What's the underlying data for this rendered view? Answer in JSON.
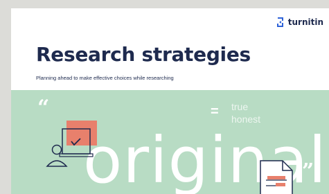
{
  "brand": {
    "name": "turnitin",
    "accent": "#2e62d8"
  },
  "header": {
    "title": "Research strategies",
    "subtitle": "Planning ahead to make effective choices while researching"
  },
  "hero": {
    "background": "#b8dcc4",
    "quote_open": "“",
    "quote_close": "”",
    "equals": "=",
    "words": [
      "true",
      "honest"
    ],
    "big_word": "original"
  },
  "colors": {
    "navy": "#1e2a4e",
    "coral": "#e8806c"
  },
  "icons": [
    "turnitin-logo-icon",
    "user-at-screen-icon",
    "document-icon"
  ]
}
